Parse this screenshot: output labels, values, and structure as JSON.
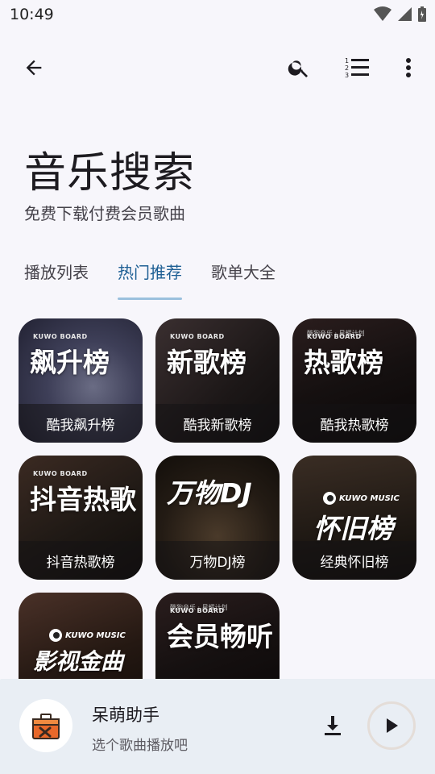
{
  "status_bar": {
    "time": "10:49"
  },
  "header": {
    "title": "音乐搜索",
    "subtitle": "免费下载付费会员歌曲"
  },
  "tabs": [
    {
      "label": "播放列表",
      "active": false
    },
    {
      "label": "热门推荐",
      "active": true
    },
    {
      "label": "歌单大全",
      "active": false
    }
  ],
  "cards": [
    {
      "big": "飙升榜",
      "brand": "KUWO BOARD",
      "caption": "酷我飙升榜"
    },
    {
      "big": "新歌榜",
      "brand": "KUWO BOARD",
      "caption": "酷我新歌榜"
    },
    {
      "big": "热歌榜",
      "brand": "KUWO BOARD",
      "top_text": "酷狗音乐 · 星耀计划",
      "caption": "酷我热歌榜"
    },
    {
      "big": "抖音热歌",
      "brand": "KUWO BOARD",
      "caption": "抖音热歌榜"
    },
    {
      "big": "万物DJ",
      "brand": "",
      "caption": "万物DJ榜"
    },
    {
      "big": "怀旧榜",
      "brand": "KUWO MUSIC",
      "caption": "经典怀旧榜"
    },
    {
      "big": "影视金曲",
      "brand": "KUWO MUSIC",
      "caption": ""
    },
    {
      "big": "会员畅听",
      "brand": "KUWO BOARD",
      "top_text": "酷狗音乐 · 星耀计划",
      "caption": ""
    }
  ],
  "player": {
    "title": "呆萌助手",
    "subtitle": "选个歌曲播放吧"
  },
  "colors": {
    "accent": "#1e5f94",
    "tab_indicator": "#9ac0dd",
    "player_bg": "#e9eef4",
    "page_bg": "#f7f6fb"
  },
  "icons": {
    "back": "arrow-left-icon",
    "search": "search-icon",
    "list": "numbered-list-icon",
    "more": "more-vert-icon",
    "download": "download-icon",
    "play": "play-icon",
    "avatar": "toolbox-icon"
  }
}
